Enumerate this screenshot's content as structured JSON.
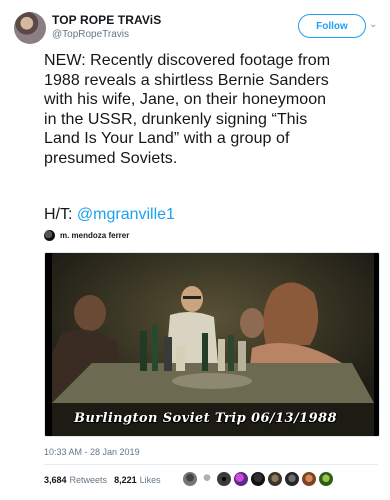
{
  "author": {
    "display_name": "TOP ROPE TRAViS",
    "handle": "@TopRopeTravis"
  },
  "follow_label": "Follow",
  "tweet": {
    "text_lines": [
      "NEW: Recently discovered footage from",
      "1988 reveals a shirtless Bernie Sanders",
      "with his wife, Jane, on their honeymoon",
      "in the USSR, drunkenly signing “This",
      "Land Is Your Land” with a group of",
      "presumed Soviets."
    ],
    "ht_prefix": "H/T: ",
    "ht_mention": "@mgranville1"
  },
  "media": {
    "attribution": "m. mendoza ferrer",
    "caption": "Burlington Soviet Trip 06/13/1988"
  },
  "timestamp": "10:33 AM - 28 Jan 2019",
  "stats": {
    "retweets_count": "3,684",
    "retweets_label": "Retweets",
    "likes_count": "8,221",
    "likes_label": "Likes"
  },
  "colors": {
    "accent": "#1da1f2",
    "secondary_text": "#657786"
  }
}
